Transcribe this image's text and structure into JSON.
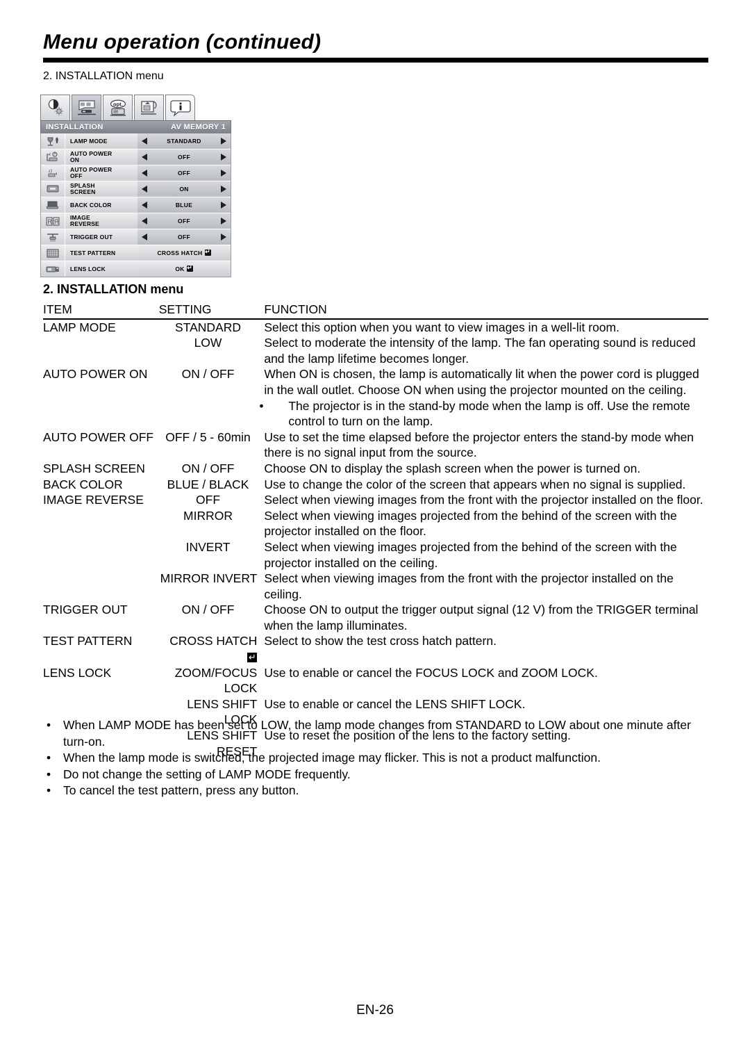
{
  "header": {
    "title": "Menu operation (continued)",
    "section_caption": "2. INSTALLATION menu"
  },
  "osd": {
    "tabs": [
      {
        "name": "image-tab",
        "icon": "contrast-brightness-icon",
        "selected": false
      },
      {
        "name": "installation-tab",
        "icon": "projector-screen-icon",
        "selected": true
      },
      {
        "name": "option-tab",
        "icon": "opt-icon",
        "selected": false
      },
      {
        "name": "feature-tab",
        "icon": "signal-setup-icon",
        "selected": false
      },
      {
        "name": "information-tab",
        "icon": "info-icon",
        "selected": false
      }
    ],
    "bar": {
      "title": "INSTALLATION",
      "memory": "AV MEMORY 1"
    },
    "rows": [
      {
        "icon": "lamp-icon",
        "label": "LAMP MODE",
        "label2": "",
        "value": "STANDARD",
        "arrows": true
      },
      {
        "icon": "auto-power-on-icon",
        "label": "AUTO POWER",
        "label2": "ON",
        "value": "OFF",
        "arrows": true
      },
      {
        "icon": "auto-power-off-icon",
        "label": "AUTO POWER",
        "label2": "OFF",
        "value": "OFF",
        "arrows": true
      },
      {
        "icon": "splash-screen-icon",
        "label": "SPLASH",
        "label2": "SCREEN",
        "value": "ON",
        "arrows": true
      },
      {
        "icon": "back-color-icon",
        "label": "BACK COLOR",
        "label2": "",
        "value": "BLUE",
        "arrows": true
      },
      {
        "icon": "image-reverse-icon",
        "label": "IMAGE",
        "label2": "REVERSE",
        "value": "OFF",
        "arrows": true
      },
      {
        "icon": "trigger-out-icon",
        "label": "TRIGGER OUT",
        "label2": "",
        "value": "OFF",
        "arrows": true
      },
      {
        "icon": "test-pattern-icon",
        "label": "TEST PATTERN",
        "label2": "",
        "value": "CROSS HATCH",
        "arrows": false,
        "enter": true
      },
      {
        "icon": "lens-lock-icon",
        "label": "LENS LOCK",
        "label2": "",
        "value": "OK",
        "arrows": false,
        "enter": true
      }
    ]
  },
  "table": {
    "heading_bold": "2. INSTALLATION",
    "heading_rest": " menu",
    "columns": [
      "ITEM",
      "SETTING",
      "FUNCTION"
    ],
    "rows": [
      {
        "item": "LAMP MODE",
        "setting": "STANDARD",
        "function": "Select this option when you want to view images in a well-lit room."
      },
      {
        "item": "",
        "setting": "LOW",
        "function": "Select to moderate the intensity of the lamp. The fan operating sound is reduced and the lamp lifetime becomes longer."
      },
      {
        "item": "AUTO POWER ON",
        "setting": "ON / OFF",
        "function": "When ON is chosen, the lamp is automatically lit when the power cord is plugged in the wall outlet. Choose ON when using the projector mounted on the ceiling.",
        "bullet": "The projector is in the stand-by mode when the lamp is off. Use the remote control to turn on the lamp."
      },
      {
        "item": "AUTO POWER OFF",
        "setting": "OFF / 5 - 60min",
        "function": "Use to set the time elapsed before the projector enters the stand-by mode when there is no signal input from the source."
      },
      {
        "item": "SPLASH SCREEN",
        "setting": "ON / OFF",
        "function": "Choose ON to display the splash screen when the power is turned on."
      },
      {
        "item": "BACK COLOR",
        "setting": "BLUE / BLACK",
        "function": "Use to change the color of the screen that appears when no signal is supplied."
      },
      {
        "item": "IMAGE REVERSE",
        "setting": "OFF",
        "function": "Select when viewing images from the front with the projector installed on the floor."
      },
      {
        "item": "",
        "setting": "MIRROR",
        "function": "Select when viewing images projected from the behind of the screen with the projector installed on the floor."
      },
      {
        "item": "",
        "setting": "INVERT",
        "function": "Select when viewing images projected from the behind of the screen with the projector installed on the ceiling."
      },
      {
        "item": "",
        "setting": "MIRROR INVERT",
        "function": "Select when viewing images from the front with the projector installed on the ceiling."
      },
      {
        "item": "TRIGGER OUT",
        "setting": "ON / OFF",
        "function": "Choose ON to output the trigger output signal (12 V) from the TRIGGER terminal when the lamp illuminates."
      },
      {
        "item": "TEST PATTERN",
        "setting": "CROSS HATCH",
        "setting_enter": true,
        "function": "Select to show the test cross hatch pattern."
      },
      {
        "item": "LENS LOCK",
        "setting": "ZOOM/FOCUS LOCK",
        "function": "Use to enable or cancel the FOCUS LOCK and ZOOM LOCK."
      },
      {
        "item": "",
        "setting": "LENS SHIFT LOCK",
        "function": "Use to enable or cancel the LENS SHIFT LOCK."
      },
      {
        "item": "",
        "setting": "LENS SHIFT RESET",
        "function": "Use to reset the position of the lens to the factory setting."
      }
    ]
  },
  "notes": [
    "When LAMP MODE has been set to LOW, the lamp mode changes from STANDARD to LOW about one minute after turn-on.",
    "When the lamp mode is switched, the projected image may flicker. This is not a product malfunction.",
    "Do not change the setting of LAMP MODE frequently.",
    "To cancel the test pattern, press any button."
  ],
  "footer": {
    "page": "EN-26"
  }
}
